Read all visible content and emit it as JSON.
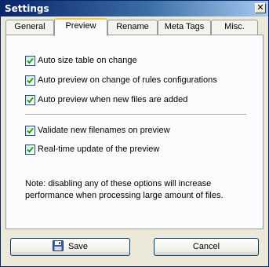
{
  "window": {
    "title": "Settings",
    "close_glyph": "✕"
  },
  "tabs": [
    {
      "label": "General",
      "active": false
    },
    {
      "label": "Preview",
      "active": true
    },
    {
      "label": "Rename",
      "active": false
    },
    {
      "label": "Meta Tags",
      "active": false
    },
    {
      "label": "Misc.",
      "active": false
    }
  ],
  "options": [
    {
      "label": "Auto size table on change",
      "checked": true
    },
    {
      "label": "Auto preview on change of rules configurations",
      "checked": true
    },
    {
      "label": "Auto preview when new files are added",
      "checked": true
    },
    {
      "label": "Validate new filenames on preview",
      "checked": true
    },
    {
      "label": "Real-time update of the preview",
      "checked": true
    }
  ],
  "note": "Note: disabling any of these options will increase performance when processing large amount of files.",
  "buttons": {
    "save": "Save",
    "cancel": "Cancel"
  },
  "icons": {
    "save": "floppy-disk-icon",
    "close": "close-icon",
    "check": "checkmark-icon"
  },
  "colors": {
    "title_bar": "#0A246A",
    "face": "#ECE9D8",
    "check": "#21A121",
    "tab_highlight": "#FFC83C"
  }
}
